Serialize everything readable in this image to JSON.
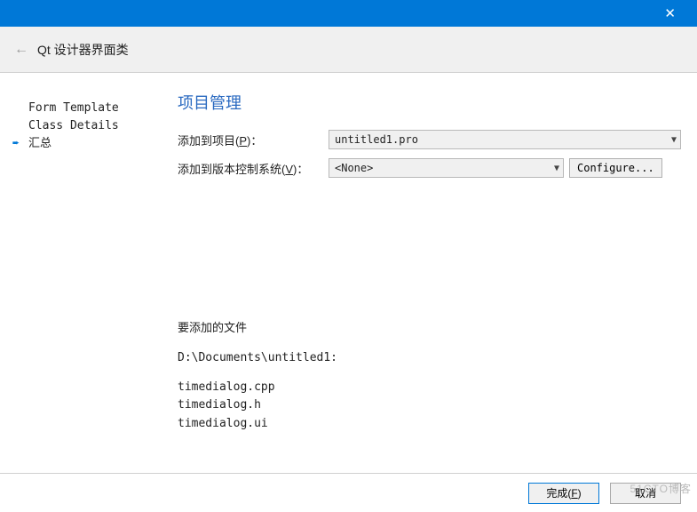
{
  "header": {
    "title": "Qt 设计器界面类"
  },
  "sidebar": {
    "items": [
      {
        "label": "Form Template",
        "current": false
      },
      {
        "label": "Class Details",
        "current": false
      },
      {
        "label": "汇总",
        "current": true
      }
    ]
  },
  "main": {
    "section_title": "项目管理",
    "add_to_project_prefix": "添加到项目(",
    "add_to_project_key": "P",
    "add_to_project_suffix": ")：",
    "project_value": "untitled1.pro",
    "add_to_vcs_prefix": "添加到版本控制系统(",
    "add_to_vcs_key": "V",
    "add_to_vcs_suffix": ")：",
    "vcs_value": "<None>",
    "configure_label": "Configure...",
    "files_heading": "要添加的文件",
    "files_path": "D:\\Documents\\untitled1:",
    "files": [
      "timedialog.cpp",
      "timedialog.h",
      "timedialog.ui"
    ]
  },
  "footer": {
    "finish_prefix": "完成(",
    "finish_key": "F",
    "finish_suffix": ")",
    "cancel": "取消"
  },
  "watermark": "51CTO博客"
}
